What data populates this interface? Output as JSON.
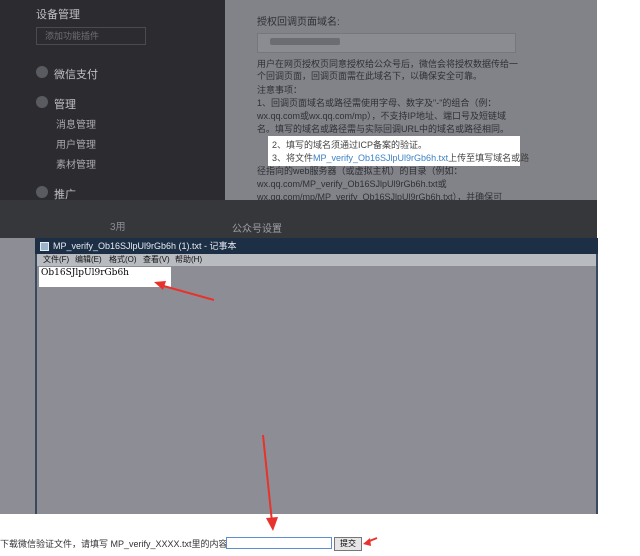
{
  "backdrop": {
    "nav": {
      "item_device": "设备管理",
      "add_plugin": "添加功能插件",
      "item_payment": "微信支付",
      "item_manage": "管理",
      "sub_messages": "消息管理",
      "sub_users": "用户管理",
      "sub_materials": "素材管理",
      "item_promo": "推广"
    },
    "panel": {
      "heading": "授权回调页面域名:",
      "description": "用户在网页授权页同意授权给公众号后，微信会将授权数据传给一个回调页面，回调页面需在此域名下，以确保安全可靠。",
      "notes_title": "注意事项：",
      "note_1_line_a": "1、回调页面域名或路径需使用字母、数字及\"-\"的组合（例：",
      "note_1_line_b": "wx.qq.com或wx.qq.com/mp），不支持IP地址、端口号及短链域",
      "note_1_line_c": "名。填写的域名或路径需与实际回调URL中的域名或路径相同。",
      "note_2": "2、填写的域名须通过ICP备案的验证。",
      "note_3_prefix": "3、将文件",
      "note_3_link": "MP_verify_Ob16SJlpUl9rGb6h.txt",
      "note_3_suffix": "上传至填写域名或路",
      "note_3_line_b": "径指向的web服务器（或虚拟主机）的目录（例如：",
      "note_3_line_c": "wx.qq.com/MP_verify_Ob16SJlpUl9rGb6h.txt或",
      "note_3_line_d": "wx.qq.com/mp/MP_verify_Ob16SJlpUl9rGb6h.txt），并确保可"
    },
    "lower": {
      "left_label": "3用",
      "right_label": "公众号设置"
    }
  },
  "notepad": {
    "title": "MP_verify_Ob16SJlpUl9rGb6h (1).txt - 记事本",
    "menus": [
      "文件(F)",
      "编辑(E)",
      "格式(O)",
      "查看(V)",
      "帮助(H)"
    ],
    "content": "Ob16SJlpUl9rGb6h"
  },
  "form": {
    "label": "下载微信验证文件，请填写 MP_verify_XXXX.txt里的内容：",
    "input_value": "",
    "submit_label": "提交"
  },
  "colors": {
    "arrow": "#e8322b",
    "overlay": "#8d8e95",
    "link": "#3b82c4"
  }
}
